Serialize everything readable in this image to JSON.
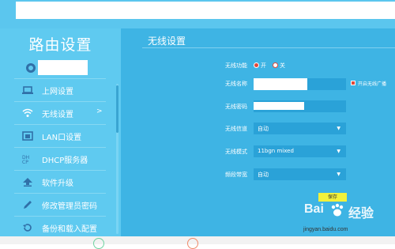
{
  "sidebar": {
    "title": "路由设置",
    "items": [
      {
        "label": "上网设置",
        "icon": "laptop-icon"
      },
      {
        "label": "无线设置",
        "icon": "wifi-icon",
        "arrow": ">"
      },
      {
        "label": "LAN口设置",
        "icon": "lan-port-icon"
      },
      {
        "label": "DHCP服务器",
        "icon": "dhcp-icon"
      },
      {
        "label": "软件升级",
        "icon": "upgrade-icon"
      },
      {
        "label": "修改管理员密码",
        "icon": "pencil-icon"
      },
      {
        "label": "备份和载入配置",
        "icon": "restore-icon"
      }
    ]
  },
  "main": {
    "title": "无线设置",
    "wifi_function": {
      "label": "无线功能",
      "on_label": "开",
      "off_label": "关",
      "selected": "开"
    },
    "ssid": {
      "label": "无线名称",
      "hide_label": "开启无线广播",
      "hide_checked": true
    },
    "password": {
      "label": "无线密码"
    },
    "channel": {
      "label": "无线信道",
      "value": "自动"
    },
    "mode": {
      "label": "无线模式",
      "value": "11bgn mixed"
    },
    "bandwidth": {
      "label": "频段带宽",
      "value": "自动"
    },
    "save_label": "保存"
  },
  "watermark": {
    "brand": "Bai",
    "brand2": "经验",
    "url": "jingyan.baidu.com"
  },
  "colors": {
    "sidebar_bg": "#5fcaf0",
    "main_bg": "#3eb4e4",
    "input_bg": "#2aa2d8",
    "radio_accent": "#e2493a",
    "save_button": "#f2f13b"
  }
}
